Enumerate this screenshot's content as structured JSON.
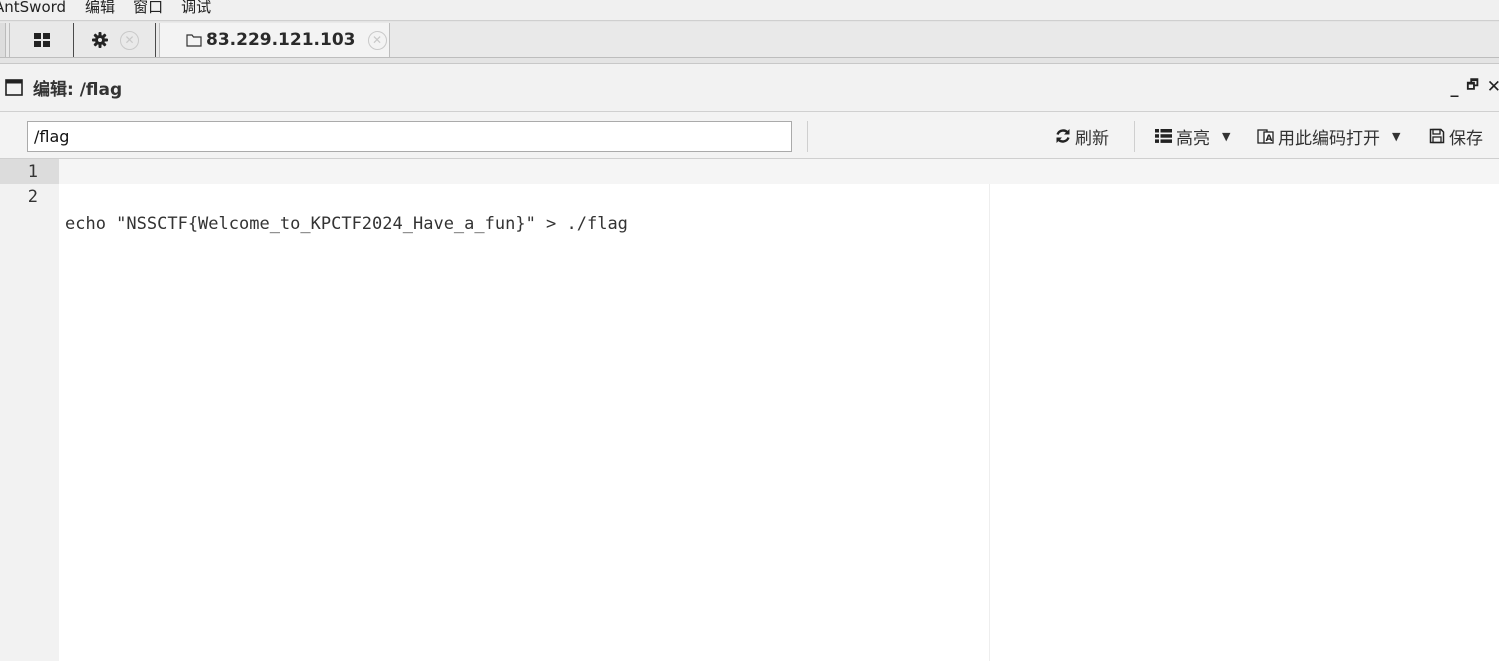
{
  "menu": {
    "items": [
      "AntSword",
      "编辑",
      "窗口",
      "调试"
    ]
  },
  "tabs": {
    "grid_icon": "grid-icon",
    "settings_icon": "gear-icon",
    "active_tab": {
      "icon": "folder-icon",
      "title": "83.229.121.103"
    }
  },
  "window": {
    "title": "编辑: /flag",
    "controls": [
      "_",
      "🗗",
      "✕"
    ]
  },
  "toolbar": {
    "path_value": "/flag",
    "refresh_label": "刷新",
    "highlight_label": "高亮",
    "open_with_encoding_label": "用此编码打开",
    "save_label": "保存"
  },
  "editor": {
    "line_numbers": [
      "1",
      "2"
    ],
    "lines": [
      "echo \"NSSCTF{Welcome_to_KPCTF2024_Have_a_fun}\" > ./flag",
      ""
    ]
  },
  "colors": {
    "accent": "#333333",
    "gutter_bg": "#f2f2f2",
    "toolbar_bg": "#f3f3f3"
  }
}
